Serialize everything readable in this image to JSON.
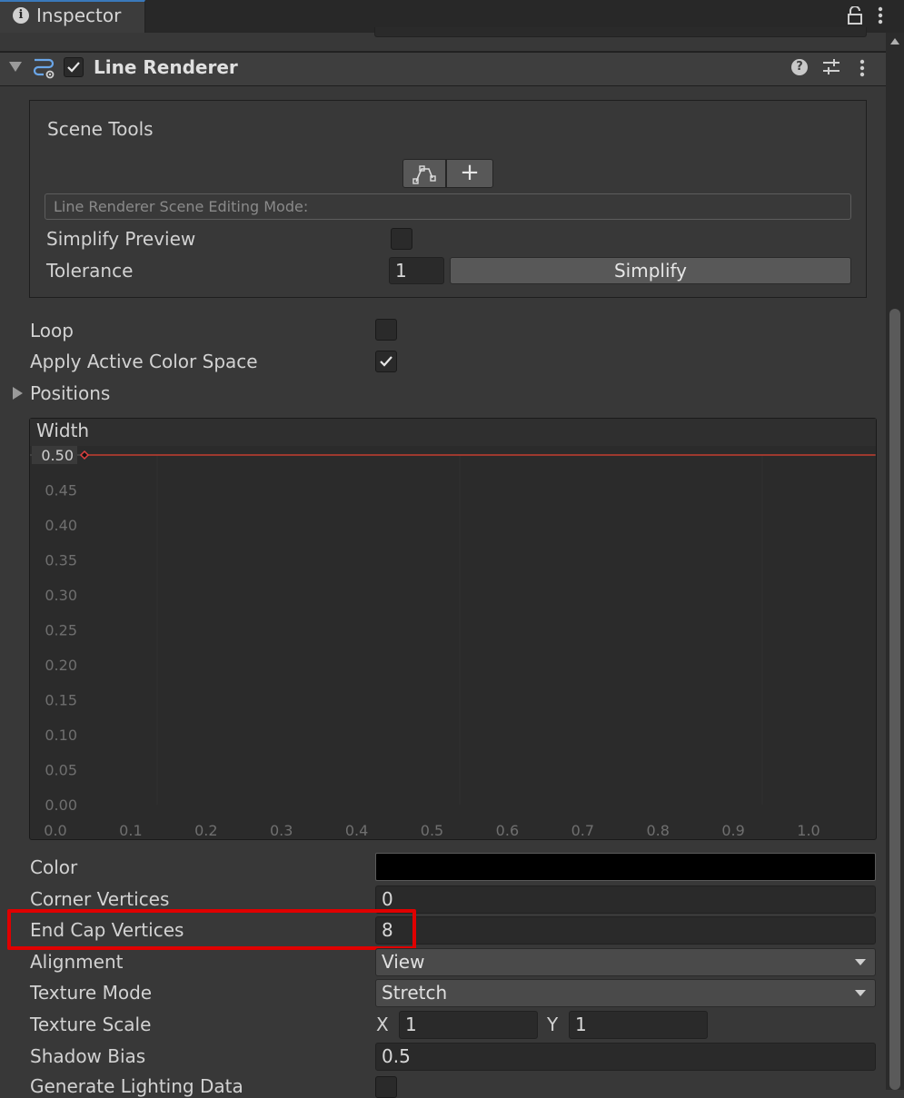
{
  "tab": {
    "label": "Inspector"
  },
  "component": {
    "title": "Line Renderer",
    "enabled": true
  },
  "scene_tools": {
    "title": "Scene Tools",
    "edit_button_icon": "edit-points-icon",
    "add_button_label": "+",
    "mode_label": "Line Renderer Scene Editing Mode:",
    "simplify_preview_label": "Simplify Preview",
    "simplify_preview_checked": false,
    "tolerance_label": "Tolerance",
    "tolerance_value": "1",
    "simplify_button": "Simplify"
  },
  "props": {
    "loop_label": "Loop",
    "loop_checked": false,
    "apply_color_space_label": "Apply Active Color Space",
    "apply_color_space_checked": true,
    "positions_label": "Positions"
  },
  "width_curve": {
    "title": "Width",
    "current_value_label": "0.50"
  },
  "chart_data": {
    "type": "line",
    "title": "Width",
    "x_ticks": [
      "0.0",
      "0.1",
      "0.2",
      "0.3",
      "0.4",
      "0.5",
      "0.6",
      "0.7",
      "0.8",
      "0.9",
      "1.0"
    ],
    "y_ticks": [
      "0.00",
      "0.05",
      "0.10",
      "0.15",
      "0.20",
      "0.25",
      "0.30",
      "0.35",
      "0.40",
      "0.45",
      "0.50"
    ],
    "xlim": [
      0,
      1.1
    ],
    "ylim": [
      0,
      0.5
    ],
    "series": [
      {
        "x": [
          0,
          1.05
        ],
        "y": [
          0.5,
          0.5
        ],
        "color": "#c0392b"
      }
    ],
    "keys": [
      {
        "x": 0,
        "y": 0.5
      }
    ]
  },
  "lower": {
    "color_label": "Color",
    "color_value": "#000000",
    "corner_vertices_label": "Corner Vertices",
    "corner_vertices_value": "0",
    "end_cap_vertices_label": "End Cap Vertices",
    "end_cap_vertices_value": "8",
    "alignment_label": "Alignment",
    "alignment_value": "View",
    "texture_mode_label": "Texture Mode",
    "texture_mode_value": "Stretch",
    "texture_scale_label": "Texture Scale",
    "texture_scale_x_label": "X",
    "texture_scale_x": "1",
    "texture_scale_y_label": "Y",
    "texture_scale_y": "1",
    "shadow_bias_label": "Shadow Bias",
    "shadow_bias_value": "0.5",
    "generate_lighting_label": "Generate Lighting Data"
  },
  "colors": {
    "highlight": "#e00000",
    "accent_tab": "#3a79bb",
    "curve": "#c0392b"
  }
}
